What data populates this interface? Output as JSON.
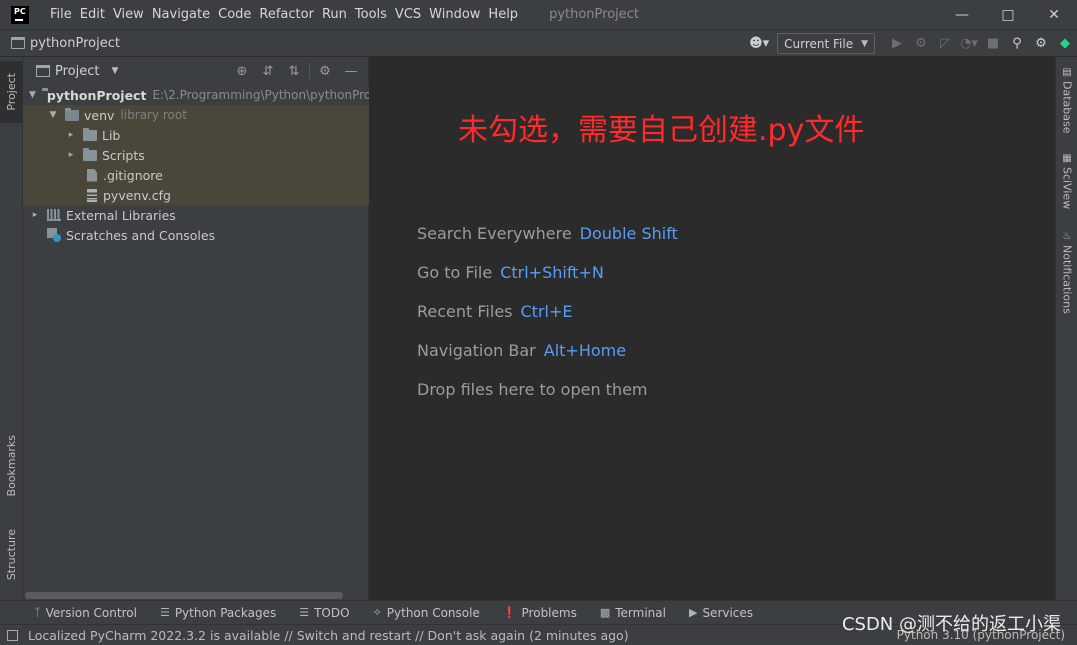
{
  "titlebar": {
    "menus": [
      "File",
      "Edit",
      "View",
      "Navigate",
      "Code",
      "Refactor",
      "Run",
      "Tools",
      "VCS",
      "Window",
      "Help"
    ],
    "window_title": "pythonProject",
    "logo_text": "PC"
  },
  "navbar": {
    "project_name": "pythonProject",
    "run_config": "Current File"
  },
  "left_stripe": {
    "project_tab": "Project",
    "bookmarks_tab": "Bookmarks",
    "structure_tab": "Structure"
  },
  "project_panel": {
    "title": "Project",
    "tree": {
      "root_name": "pythonProject",
      "root_path": "E:\\2.Programming\\Python\\pythonPro",
      "venv_name": "venv",
      "venv_note": "library root",
      "lib": "Lib",
      "scripts": "Scripts",
      "gitignore": ".gitignore",
      "pyvenv": "pyvenv.cfg",
      "external": "External Libraries",
      "scratches": "Scratches and Consoles"
    }
  },
  "editor": {
    "annotation": "未勾选，需要自己创建.py文件",
    "hints": [
      {
        "label": "Search Everywhere",
        "key": "Double Shift"
      },
      {
        "label": "Go to File",
        "key": "Ctrl+Shift+N"
      },
      {
        "label": "Recent Files",
        "key": "Ctrl+E"
      },
      {
        "label": "Navigation Bar",
        "key": "Alt+Home"
      },
      {
        "label": "Drop files here to open them",
        "key": ""
      }
    ]
  },
  "right_stripe": {
    "database": "Database",
    "sciview": "SciView",
    "notifications": "Notifications"
  },
  "bottom_tabs": [
    "Version Control",
    "Python Packages",
    "TODO",
    "Python Console",
    "Problems",
    "Terminal",
    "Services"
  ],
  "statusbar": {
    "message": "Localized PyCharm 2022.3.2 is available // Switch and restart // Don't ask again (2 minutes ago)",
    "interpreter": "Python 3.10 (pythonProject)"
  },
  "watermark": "CSDN @测不给的返工小渠",
  "colors": {
    "annotation": "#ff2a2a",
    "shortcut": "#589df6"
  }
}
